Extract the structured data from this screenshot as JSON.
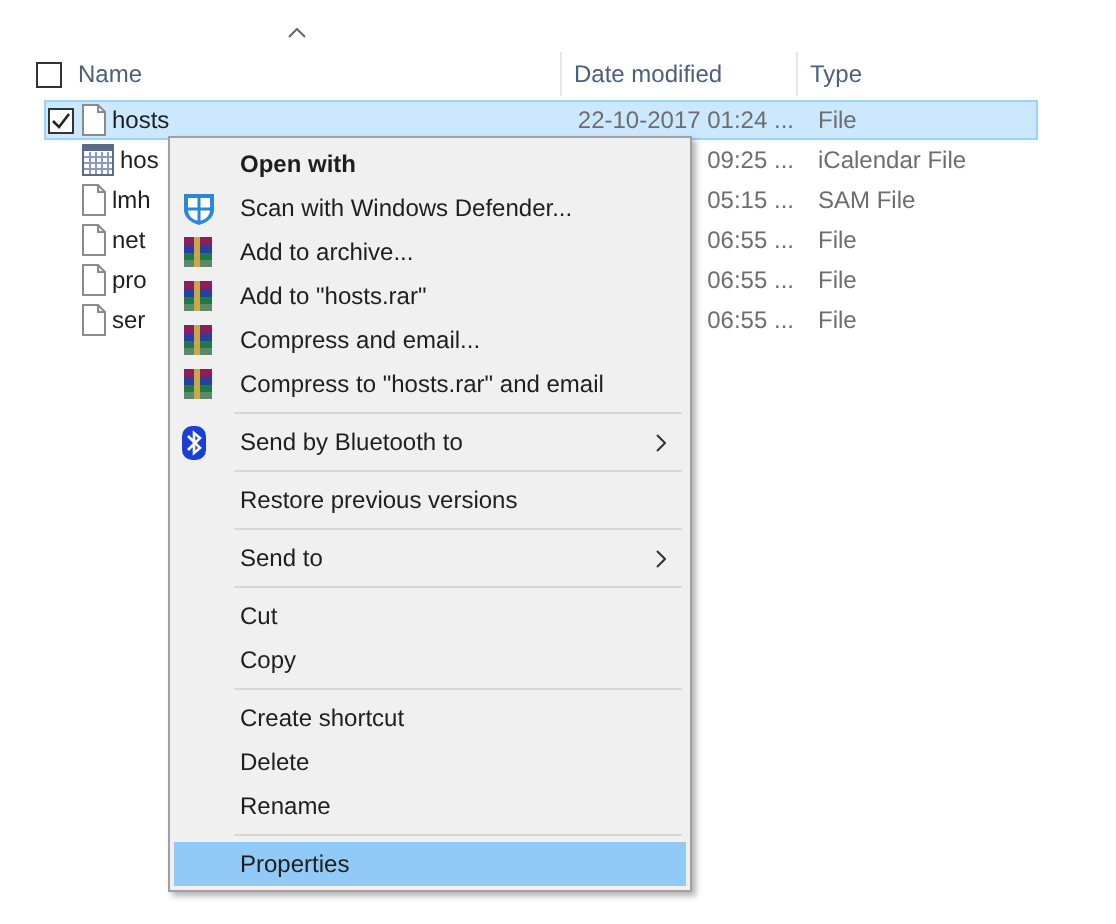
{
  "header": {
    "select_all_checked": false,
    "columns": [
      {
        "label": "Name"
      },
      {
        "label": "Date modified"
      },
      {
        "label": "Type"
      }
    ]
  },
  "rows": [
    {
      "kind": "file",
      "name": "hosts",
      "date_modified": "22-10-2017 01:24 ...",
      "type": "File",
      "selected": true,
      "checked": true
    },
    {
      "kind": "calendar",
      "name": "hos",
      "date_modified": "09:25 ...",
      "type": "iCalendar File",
      "selected": false,
      "checked": false
    },
    {
      "kind": "file",
      "name": "lmh",
      "date_modified": "05:15 ...",
      "type": "SAM File",
      "selected": false,
      "checked": false
    },
    {
      "kind": "file",
      "name": "net",
      "date_modified": "06:55 ...",
      "type": "File",
      "selected": false,
      "checked": false
    },
    {
      "kind": "file",
      "name": "pro",
      "date_modified": "06:55 ...",
      "type": "File",
      "selected": false,
      "checked": false
    },
    {
      "kind": "file",
      "name": "ser",
      "date_modified": "06:55 ...",
      "type": "File",
      "selected": false,
      "checked": false
    }
  ],
  "context_menu": [
    {
      "kind": "plain",
      "label": "Open with",
      "bold": true,
      "submenu": false,
      "selected": false
    },
    {
      "kind": "shield",
      "label": "Scan with Windows Defender...",
      "bold": false,
      "submenu": false,
      "selected": false
    },
    {
      "kind": "archive",
      "label": "Add to archive...",
      "bold": false,
      "submenu": false,
      "selected": false
    },
    {
      "kind": "archive",
      "label": "Add to \"hosts.rar\"",
      "bold": false,
      "submenu": false,
      "selected": false
    },
    {
      "kind": "archive",
      "label": "Compress and email...",
      "bold": false,
      "submenu": false,
      "selected": false
    },
    {
      "kind": "archive",
      "label": "Compress to \"hosts.rar\" and email",
      "bold": false,
      "submenu": false,
      "selected": false
    },
    {
      "kind": "separator"
    },
    {
      "kind": "bluetooth",
      "label": "Send by Bluetooth to",
      "bold": false,
      "submenu": true,
      "selected": false
    },
    {
      "kind": "separator"
    },
    {
      "kind": "plain",
      "label": "Restore previous versions",
      "bold": false,
      "submenu": false,
      "selected": false
    },
    {
      "kind": "separator"
    },
    {
      "kind": "plain",
      "label": "Send to",
      "bold": false,
      "submenu": true,
      "selected": false
    },
    {
      "kind": "separator"
    },
    {
      "kind": "plain",
      "label": "Cut",
      "bold": false,
      "submenu": false,
      "selected": false
    },
    {
      "kind": "plain",
      "label": "Copy",
      "bold": false,
      "submenu": false,
      "selected": false
    },
    {
      "kind": "separator"
    },
    {
      "kind": "plain",
      "label": "Create shortcut",
      "bold": false,
      "submenu": false,
      "selected": false
    },
    {
      "kind": "plain",
      "label": "Delete",
      "bold": false,
      "submenu": false,
      "selected": false
    },
    {
      "kind": "plain",
      "label": "Rename",
      "bold": false,
      "submenu": false,
      "selected": false
    },
    {
      "kind": "separator"
    },
    {
      "kind": "plain",
      "label": "Properties",
      "bold": false,
      "submenu": false,
      "selected": true
    }
  ]
}
